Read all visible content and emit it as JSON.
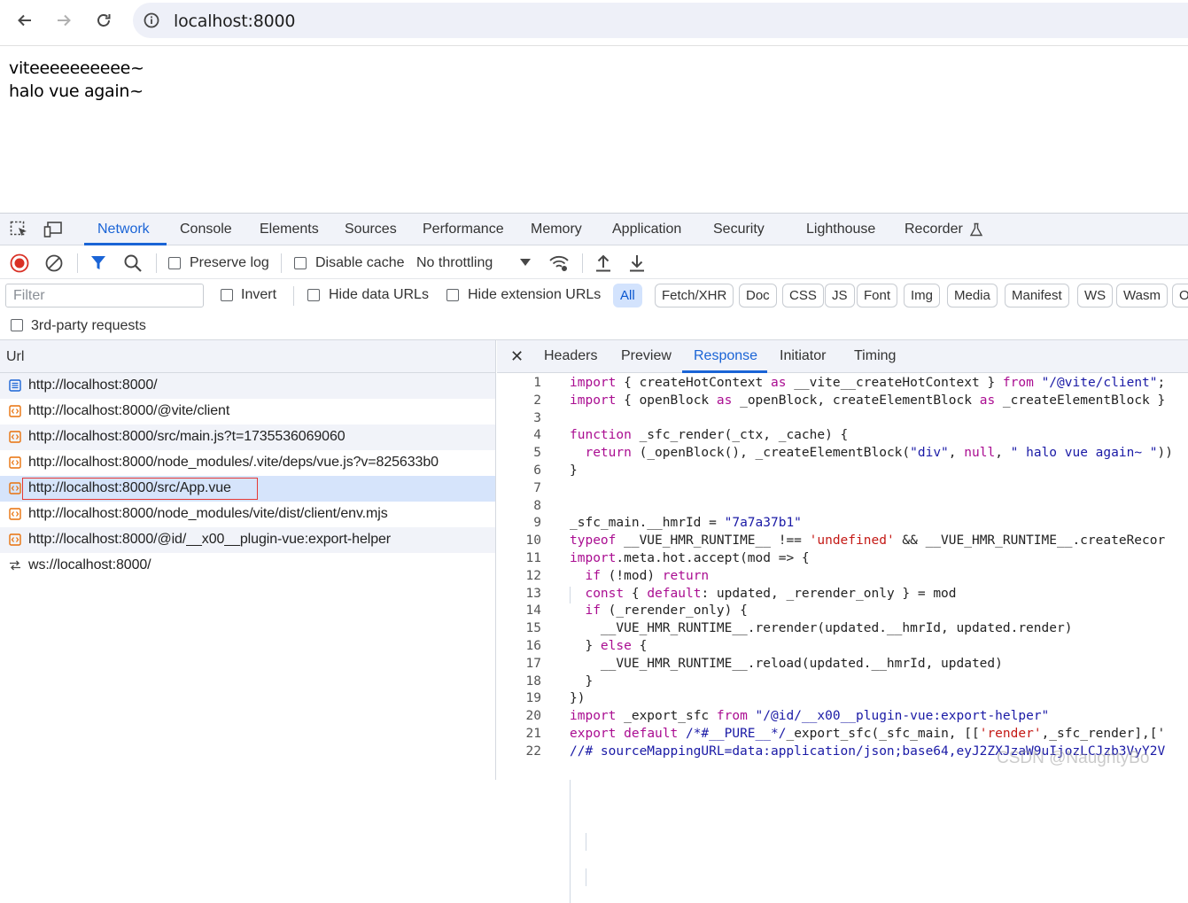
{
  "browser": {
    "url": "localhost:8000"
  },
  "page": {
    "line1": "viteeeeeeeeee~",
    "line2": "halo vue again~"
  },
  "devtools": {
    "tabs": [
      "Network",
      "Console",
      "Elements",
      "Sources",
      "Performance",
      "Memory",
      "Application",
      "Security",
      "Lighthouse",
      "Recorder"
    ],
    "active_tab": "Network",
    "toolbar": {
      "preserve_log": "Preserve log",
      "disable_cache": "Disable cache",
      "throttling": "No throttling"
    },
    "filter": {
      "placeholder": "Filter",
      "invert": "Invert",
      "hide_data_urls": "Hide data URLs",
      "hide_extension_urls": "Hide extension URLs",
      "types": [
        "All",
        "Fetch/XHR",
        "Doc",
        "CSS",
        "JS",
        "Font",
        "Img",
        "Media",
        "Manifest",
        "WS",
        "Wasm",
        "O"
      ],
      "third_party": "3rd-party requests"
    },
    "requests": {
      "header": "Url",
      "rows": [
        {
          "url": "http://localhost:8000/",
          "icon": "document-icon"
        },
        {
          "url": "http://localhost:8000/@vite/client",
          "icon": "script-icon"
        },
        {
          "url": "http://localhost:8000/src/main.js?t=1735536069060",
          "icon": "script-icon"
        },
        {
          "url": "http://localhost:8000/node_modules/.vite/deps/vue.js?v=825633b0",
          "icon": "script-icon"
        },
        {
          "url": "http://localhost:8000/src/App.vue",
          "icon": "script-icon",
          "selected": true
        },
        {
          "url": "http://localhost:8000/node_modules/vite/dist/client/env.mjs",
          "icon": "script-icon"
        },
        {
          "url": "http://localhost:8000/@id/__x00__plugin-vue:export-helper",
          "icon": "script-icon"
        },
        {
          "url": "ws://localhost:8000/",
          "icon": "websocket-icon"
        }
      ]
    },
    "detail": {
      "close": "✕",
      "tabs": [
        "Headers",
        "Preview",
        "Response",
        "Initiator",
        "Timing"
      ],
      "active_tab": "Response",
      "code_lines": [
        "import { createHotContext as __vite__createHotContext } from \"/@vite/client\";",
        "import { openBlock as _openBlock, createElementBlock as _createElementBlock }",
        "",
        "function _sfc_render(_ctx, _cache) {",
        "  return (_openBlock(), _createElementBlock(\"div\", null, \" halo vue again~ \"))",
        "}",
        "",
        "",
        "_sfc_main.__hmrId = \"7a7a37b1\"",
        "typeof __VUE_HMR_RUNTIME__ !== 'undefined' && __VUE_HMR_RUNTIME__.createRecor",
        "import.meta.hot.accept(mod => {",
        "  if (!mod) return",
        "  const { default: updated, _rerender_only } = mod",
        "  if (_rerender_only) {",
        "    __VUE_HMR_RUNTIME__.rerender(updated.__hmrId, updated.render)",
        "  } else {",
        "    __VUE_HMR_RUNTIME__.reload(updated.__hmrId, updated)",
        "  }",
        "})",
        "import _export_sfc from \"/@id/__x00__plugin-vue:export-helper\"",
        "export default /*#__PURE__*/_export_sfc(_sfc_main, [['render',_sfc_render],['",
        "//# sourceMappingURL=data:application/json;base64,eyJ2ZXJzaW9uIjozLCJzb3VyY2V"
      ]
    }
  },
  "watermark": "CSDN @NaughtyBo"
}
